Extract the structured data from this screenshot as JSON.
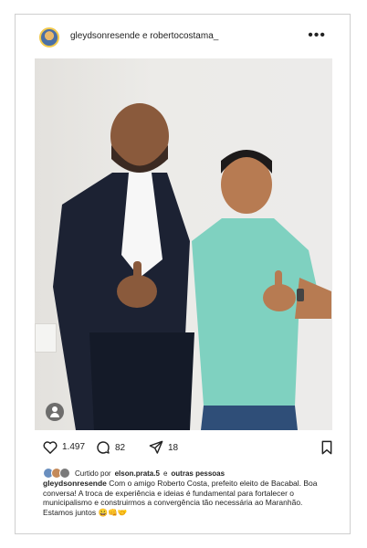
{
  "post": {
    "author": "gleydsonresende e robertocostama_",
    "more_icon": "more-horizontal-icon"
  },
  "actions": {
    "likes": "1.497",
    "comments": "82",
    "shares": "18"
  },
  "liked_by": {
    "prefix": "Curtido por",
    "user": "elson.prata.5",
    "connector": "e",
    "others": "outras pessoas"
  },
  "caption": {
    "username": "gleydsonresende",
    "text": "Com o amigo Roberto Costa, prefeito eleito de Bacabal. Boa conversa! A troca de experiência e ideias é fundamental para fortalecer o municipalismo e construirmos a convergência tão necessária ao Maranhão. Estamos juntos 😀👊🤝"
  },
  "colors": {
    "polo": "#7fd1c0",
    "suit": "#1c2233"
  }
}
